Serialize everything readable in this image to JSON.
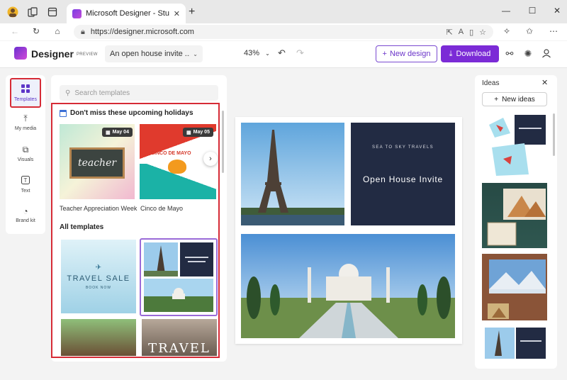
{
  "browser": {
    "tab_title": "Microsoft Designer - Stunning d",
    "url": "https://designer.microsoft.com"
  },
  "app": {
    "name": "Designer",
    "badge": "PREVIEW",
    "doc_title": "An open house invite ...",
    "zoom": "43%",
    "new_design": "New design",
    "download": "Download"
  },
  "rail": {
    "items": [
      {
        "label": "Templates",
        "icon": "templates-icon"
      },
      {
        "label": "My media",
        "icon": "upload-icon"
      },
      {
        "label": "Visuals",
        "icon": "shapes-icon"
      },
      {
        "label": "Text",
        "icon": "text-icon"
      },
      {
        "label": "Brand kit",
        "icon": "palette-icon"
      }
    ]
  },
  "templates_panel": {
    "search_placeholder": "Search templates",
    "holidays_heading": "Don't miss these upcoming holidays",
    "cards": [
      {
        "label": "Teacher Appreciation Week",
        "date": "May 04",
        "art_text": "teacher"
      },
      {
        "label": "Cinco de Mayo",
        "date": "May 05",
        "art_text": "CINCO DE MAYO"
      }
    ],
    "all_heading": "All templates",
    "travel_sale": "TRAVEL SALE",
    "travel_sub": "BOOK NOW",
    "travel_word": "TRAVEL"
  },
  "canvas": {
    "company": "SEA TO SKY TRAVELS",
    "headline": "Open House Invite"
  },
  "ideas": {
    "title": "Ideas",
    "new_ideas": "New ideas"
  },
  "colors": {
    "accent": "#7b2bd6",
    "highlight_red": "#d62b36",
    "dark_card": "#222b43"
  }
}
